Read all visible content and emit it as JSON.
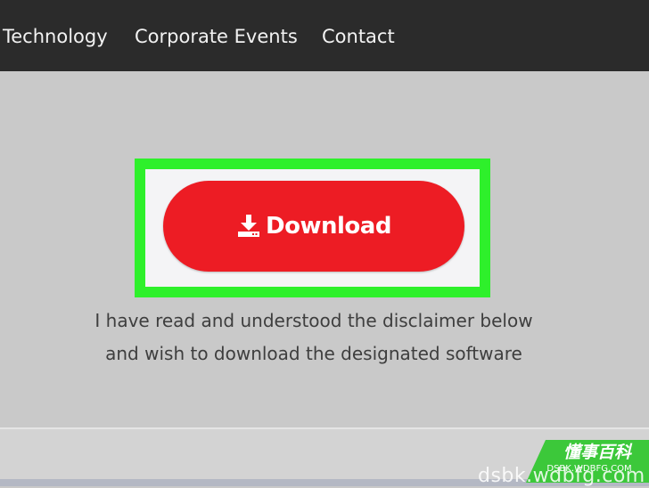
{
  "nav": {
    "items": [
      {
        "label": "Technology"
      },
      {
        "label": "Corporate Events"
      },
      {
        "label": "Contact"
      }
    ]
  },
  "download": {
    "label": "Download",
    "icon": "download-icon",
    "color": "#ed1c24",
    "highlight_color": "#2ef02b"
  },
  "disclaimer": {
    "line1": "I have read and understood the disclaimer below",
    "line2": "and wish to download the designated software"
  },
  "watermark": {
    "badge_text": "懂事百科",
    "badge_url": "DSBK.WDBFG.COM",
    "site_text": "dsbk.wdbfg.com",
    "badge_color": "#3cc83a"
  }
}
